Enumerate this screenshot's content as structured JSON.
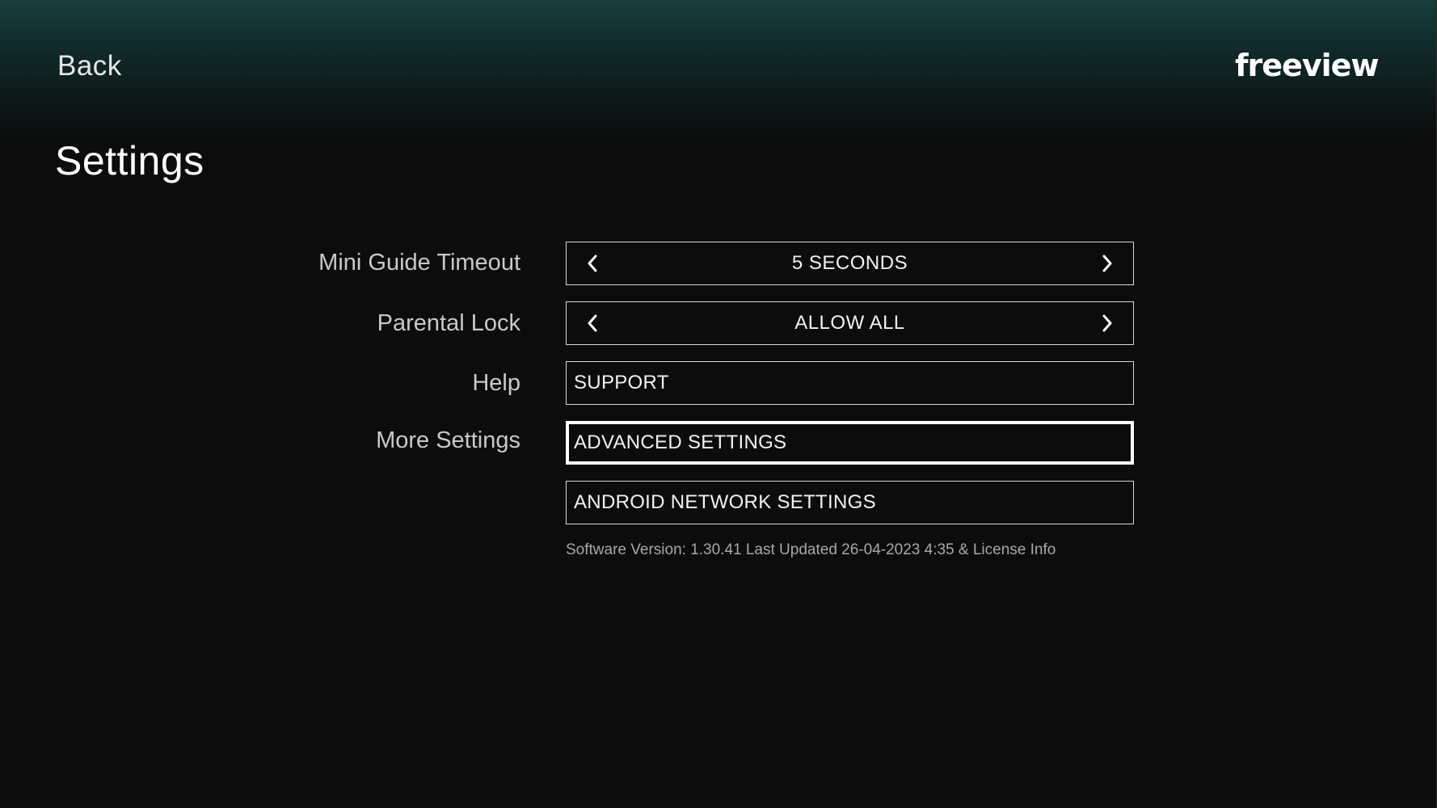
{
  "header": {
    "back_label": "Back",
    "logo_text": "freeview"
  },
  "page": {
    "title": "Settings"
  },
  "settings": {
    "mini_guide_timeout": {
      "label": "Mini Guide Timeout",
      "value": "5 SECONDS"
    },
    "parental_lock": {
      "label": "Parental Lock",
      "value": "ALLOW ALL"
    },
    "help": {
      "label": "Help",
      "button": "SUPPORT"
    },
    "more_settings": {
      "label": "More Settings",
      "advanced_button": "ADVANCED SETTINGS",
      "android_network_button": "ANDROID NETWORK SETTINGS"
    }
  },
  "footer": {
    "version_info": "Software Version: 1.30.41 Last Updated 26-04-2023 4:35 & License Info"
  },
  "icons": {
    "prev": "chevron-left-icon",
    "next": "chevron-right-icon"
  },
  "colors": {
    "background": "#0c0c0c",
    "header_teal": "#173d3d",
    "text_primary": "#ffffff",
    "text_label": "#c9c9c9",
    "text_muted": "#a8a8a8"
  }
}
